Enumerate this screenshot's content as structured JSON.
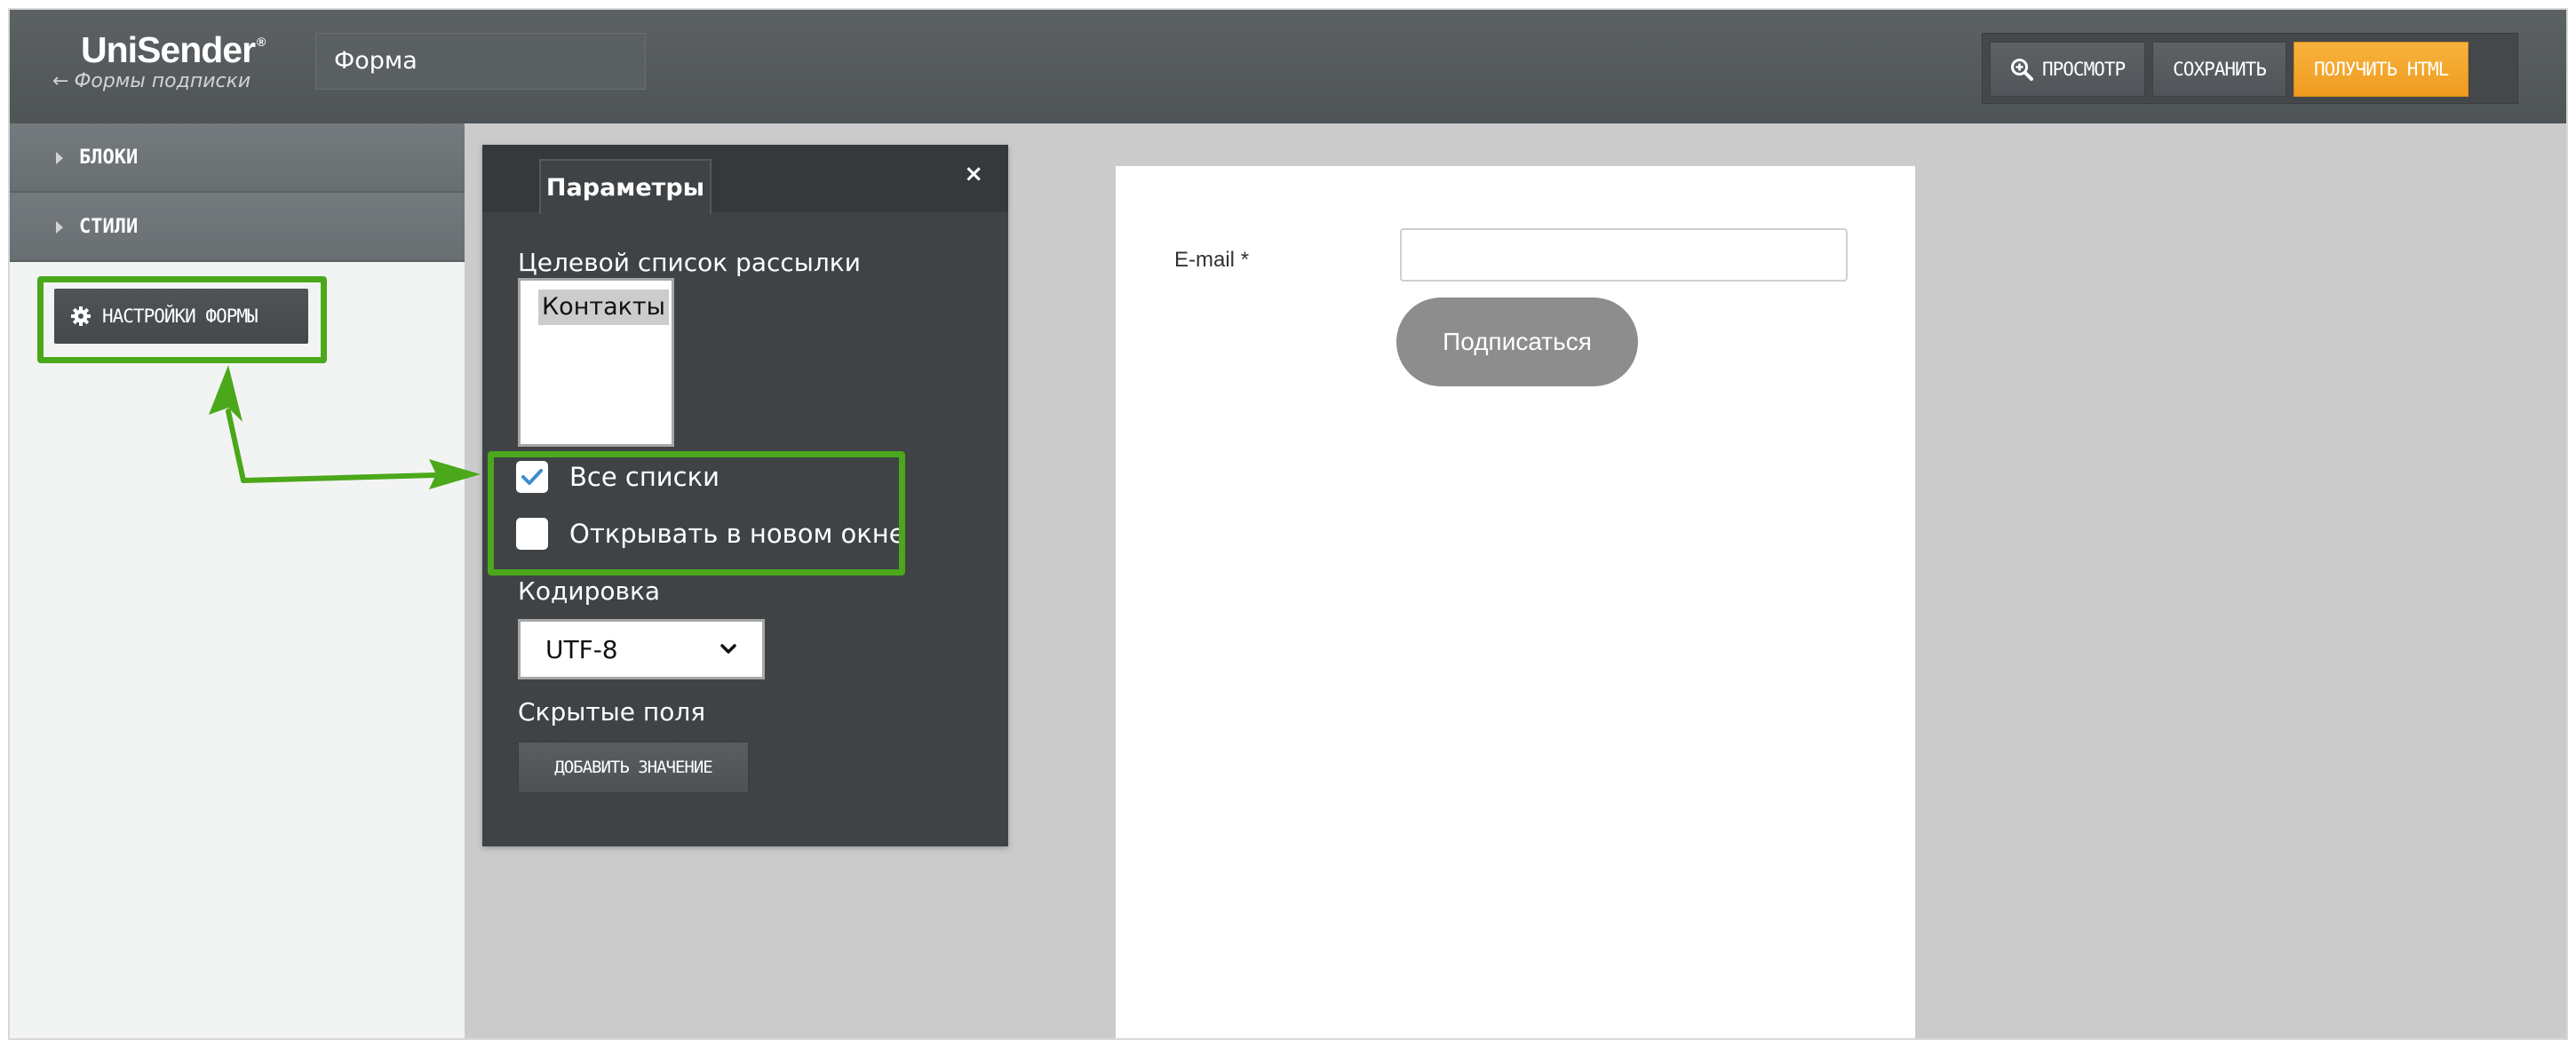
{
  "header": {
    "logo": "UniSender",
    "logo_mark": "®",
    "back_link": "Формы подписки",
    "form_name": "Форма",
    "buttons": {
      "preview": "ПРОСМОТР",
      "save": "СОХРАНИТЬ",
      "get_html": "ПОЛУЧИТЬ HTML"
    }
  },
  "sidebar": {
    "sections": [
      {
        "label": "БЛОКИ"
      },
      {
        "label": "СТИЛИ"
      }
    ],
    "settings_button": "НАСТРОЙКИ ФОРМЫ"
  },
  "panel": {
    "tab": "Параметры",
    "close": "×",
    "target_list_label": "Целевой список рассылки",
    "list_options": [
      "Контакты"
    ],
    "all_lists_label": "Все списки",
    "all_lists_checked": true,
    "new_window_label": "Открывать в новом окне",
    "new_window_checked": false,
    "encoding_label": "Кодировка",
    "encoding_value": "UTF-8",
    "hidden_fields_label": "Скрытые поля",
    "add_value_button": "ДОБАВИТЬ ЗНАЧЕНИЕ"
  },
  "preview_form": {
    "email_label": "E-mail",
    "required_mark": "*",
    "email_value": "",
    "subscribe_button": "Подписаться"
  },
  "colors": {
    "accent_orange": "#f4a52c",
    "annotation_green": "#4aa81a",
    "header_bg": "#54595c",
    "panel_bg": "#3f4346"
  }
}
